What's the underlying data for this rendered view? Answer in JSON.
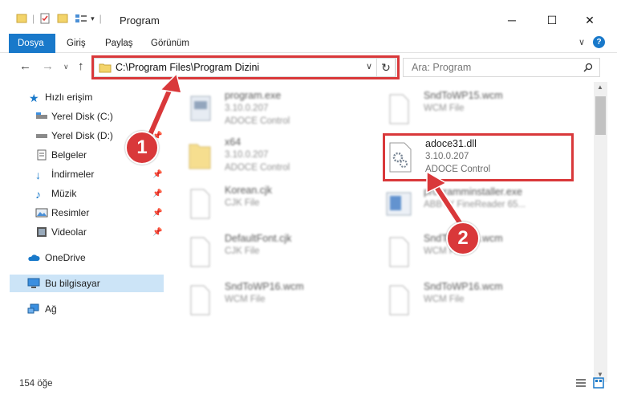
{
  "window": {
    "title": "Program"
  },
  "ribbon": {
    "tabs": [
      "Dosya",
      "Giriş",
      "Paylaş",
      "Görünüm"
    ]
  },
  "address": {
    "path": "C:\\Program Files\\Program Dizini"
  },
  "search": {
    "placeholder": "Ara: Program"
  },
  "sidebar": {
    "items": [
      {
        "label": "Hızlı erişim",
        "icon": "star-icon"
      },
      {
        "label": "Yerel Disk (C:)",
        "icon": "drive-icon"
      },
      {
        "label": "Yerel Disk (D:)",
        "icon": "drive-icon"
      },
      {
        "label": "Belgeler",
        "icon": "documents-icon"
      },
      {
        "label": "İndirmeler",
        "icon": "download-icon"
      },
      {
        "label": "Müzik",
        "icon": "music-icon"
      },
      {
        "label": "Resimler",
        "icon": "pictures-icon"
      },
      {
        "label": "Videolar",
        "icon": "video-icon"
      },
      {
        "label": "OneDrive",
        "icon": "cloud-icon"
      },
      {
        "label": "Bu bilgisayar",
        "icon": "computer-icon"
      },
      {
        "label": "Ağ",
        "icon": "network-icon"
      }
    ]
  },
  "files": [
    {
      "name": "program.exe",
      "version": "3.10.0.207",
      "type": "ADOCE Control"
    },
    {
      "name": "SndToWP15.wcm",
      "version": "",
      "type": "WCM File"
    },
    {
      "name": "x64",
      "version": "3.10.0.207",
      "type": "ADOCE Control"
    },
    {
      "name": "adoce31.dll",
      "version": "3.10.0.207",
      "type": "ADOCE Control"
    },
    {
      "name": "Korean.cjk",
      "version": "",
      "type": "CJK File"
    },
    {
      "name": "programminstaller.exe",
      "version": "",
      "type": "ABBYY FineReader 65..."
    },
    {
      "name": "DefaultFont.cjk",
      "version": "",
      "type": "CJK File"
    },
    {
      "name": "SndToWP15.wcm",
      "version": "",
      "type": "WCM File"
    },
    {
      "name": "SndToWP16.wcm",
      "version": "",
      "type": "WCM File"
    },
    {
      "name": "SndToWP16.wcm",
      "version": "",
      "type": "WCM File"
    }
  ],
  "status": {
    "count": "154 öğe"
  },
  "annotations": {
    "step1": "1",
    "step2": "2"
  },
  "colors": {
    "accent": "#1979ca",
    "annotation": "#d9383a",
    "selected": "#cce4f7"
  }
}
